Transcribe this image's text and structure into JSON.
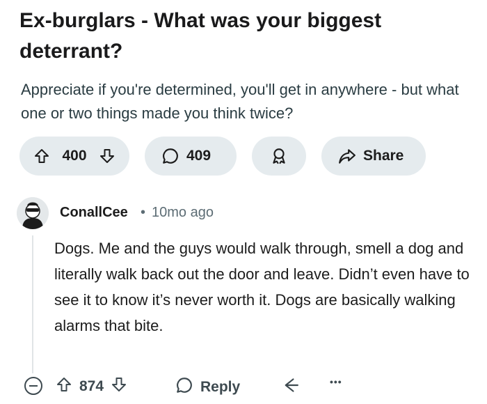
{
  "post": {
    "title": "Ex-burglars - What was your biggest deterrant?",
    "body": "Appreciate if you're determined, you'll get in anywhere - but what one or two things made you think twice?",
    "votes": "400",
    "comments": "409",
    "share_label": "Share"
  },
  "comment": {
    "username": "ConallCee",
    "separator": "•",
    "time": "10mo ago",
    "body": "Dogs. Me and the guys would walk through, smell a dog and literally walk back out the door and leave. Didn’t even have to see it to know it’s never worth it. Dogs are basically walking alarms that bite.",
    "votes": "874",
    "reply_label": "Reply",
    "more_label": "•••"
  },
  "icons": {
    "upvote": "arrow-up-icon",
    "downvote": "arrow-down-icon",
    "comments": "speech-bubble-icon",
    "award": "award-icon",
    "share": "share-arrow-icon",
    "collapse": "collapse-minus-icon",
    "reply": "speech-bubble-icon",
    "share_comment": "share-arrow-icon",
    "more": "ellipsis-icon"
  }
}
